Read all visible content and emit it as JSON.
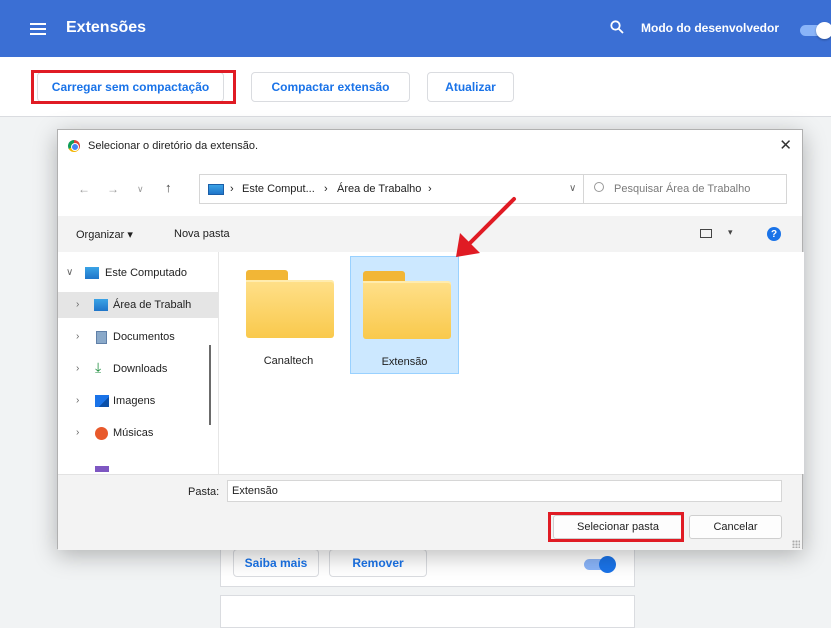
{
  "header": {
    "title": "Extensões",
    "dev_mode_label": "Modo do desenvolvedor",
    "dev_mode_on": true
  },
  "toolbar": {
    "load_unpacked": "Carregar sem compactação",
    "pack_extension": "Compactar extensão",
    "update": "Atualizar"
  },
  "background_card": {
    "details": "Saiba mais",
    "remove": "Remover",
    "enabled": true
  },
  "dialog": {
    "title": "Selecionar o diretório da extensão.",
    "close_glyph": "✕",
    "address": {
      "sep": "›",
      "crumb1": "Este Comput...",
      "crumb2": "Área de Trabalho"
    },
    "search_placeholder": "Pesquisar Área de Trabalho",
    "commands": {
      "organize": "Organizar ▾",
      "new_folder": "Nova pasta"
    },
    "nav_tree": [
      {
        "label": "Este Computado",
        "arrow": "∨"
      },
      {
        "label": "Área de Trabalh",
        "arrow": "›"
      },
      {
        "label": "Documentos",
        "arrow": "›"
      },
      {
        "label": "Downloads",
        "arrow": "›"
      },
      {
        "label": "Imagens",
        "arrow": "›"
      },
      {
        "label": "Músicas",
        "arrow": "›"
      }
    ],
    "folders": [
      {
        "name": "Canaltech",
        "selected": false
      },
      {
        "name": "Extensão",
        "selected": true
      }
    ],
    "folder_field_label": "Pasta:",
    "folder_field_value": "Extensão",
    "select_button": "Selecionar pasta",
    "cancel_button": "Cancelar"
  },
  "colors": {
    "header_blue": "#3b6fd4",
    "highlight_red": "#e01b24",
    "selection_blue": "#cce8ff"
  }
}
